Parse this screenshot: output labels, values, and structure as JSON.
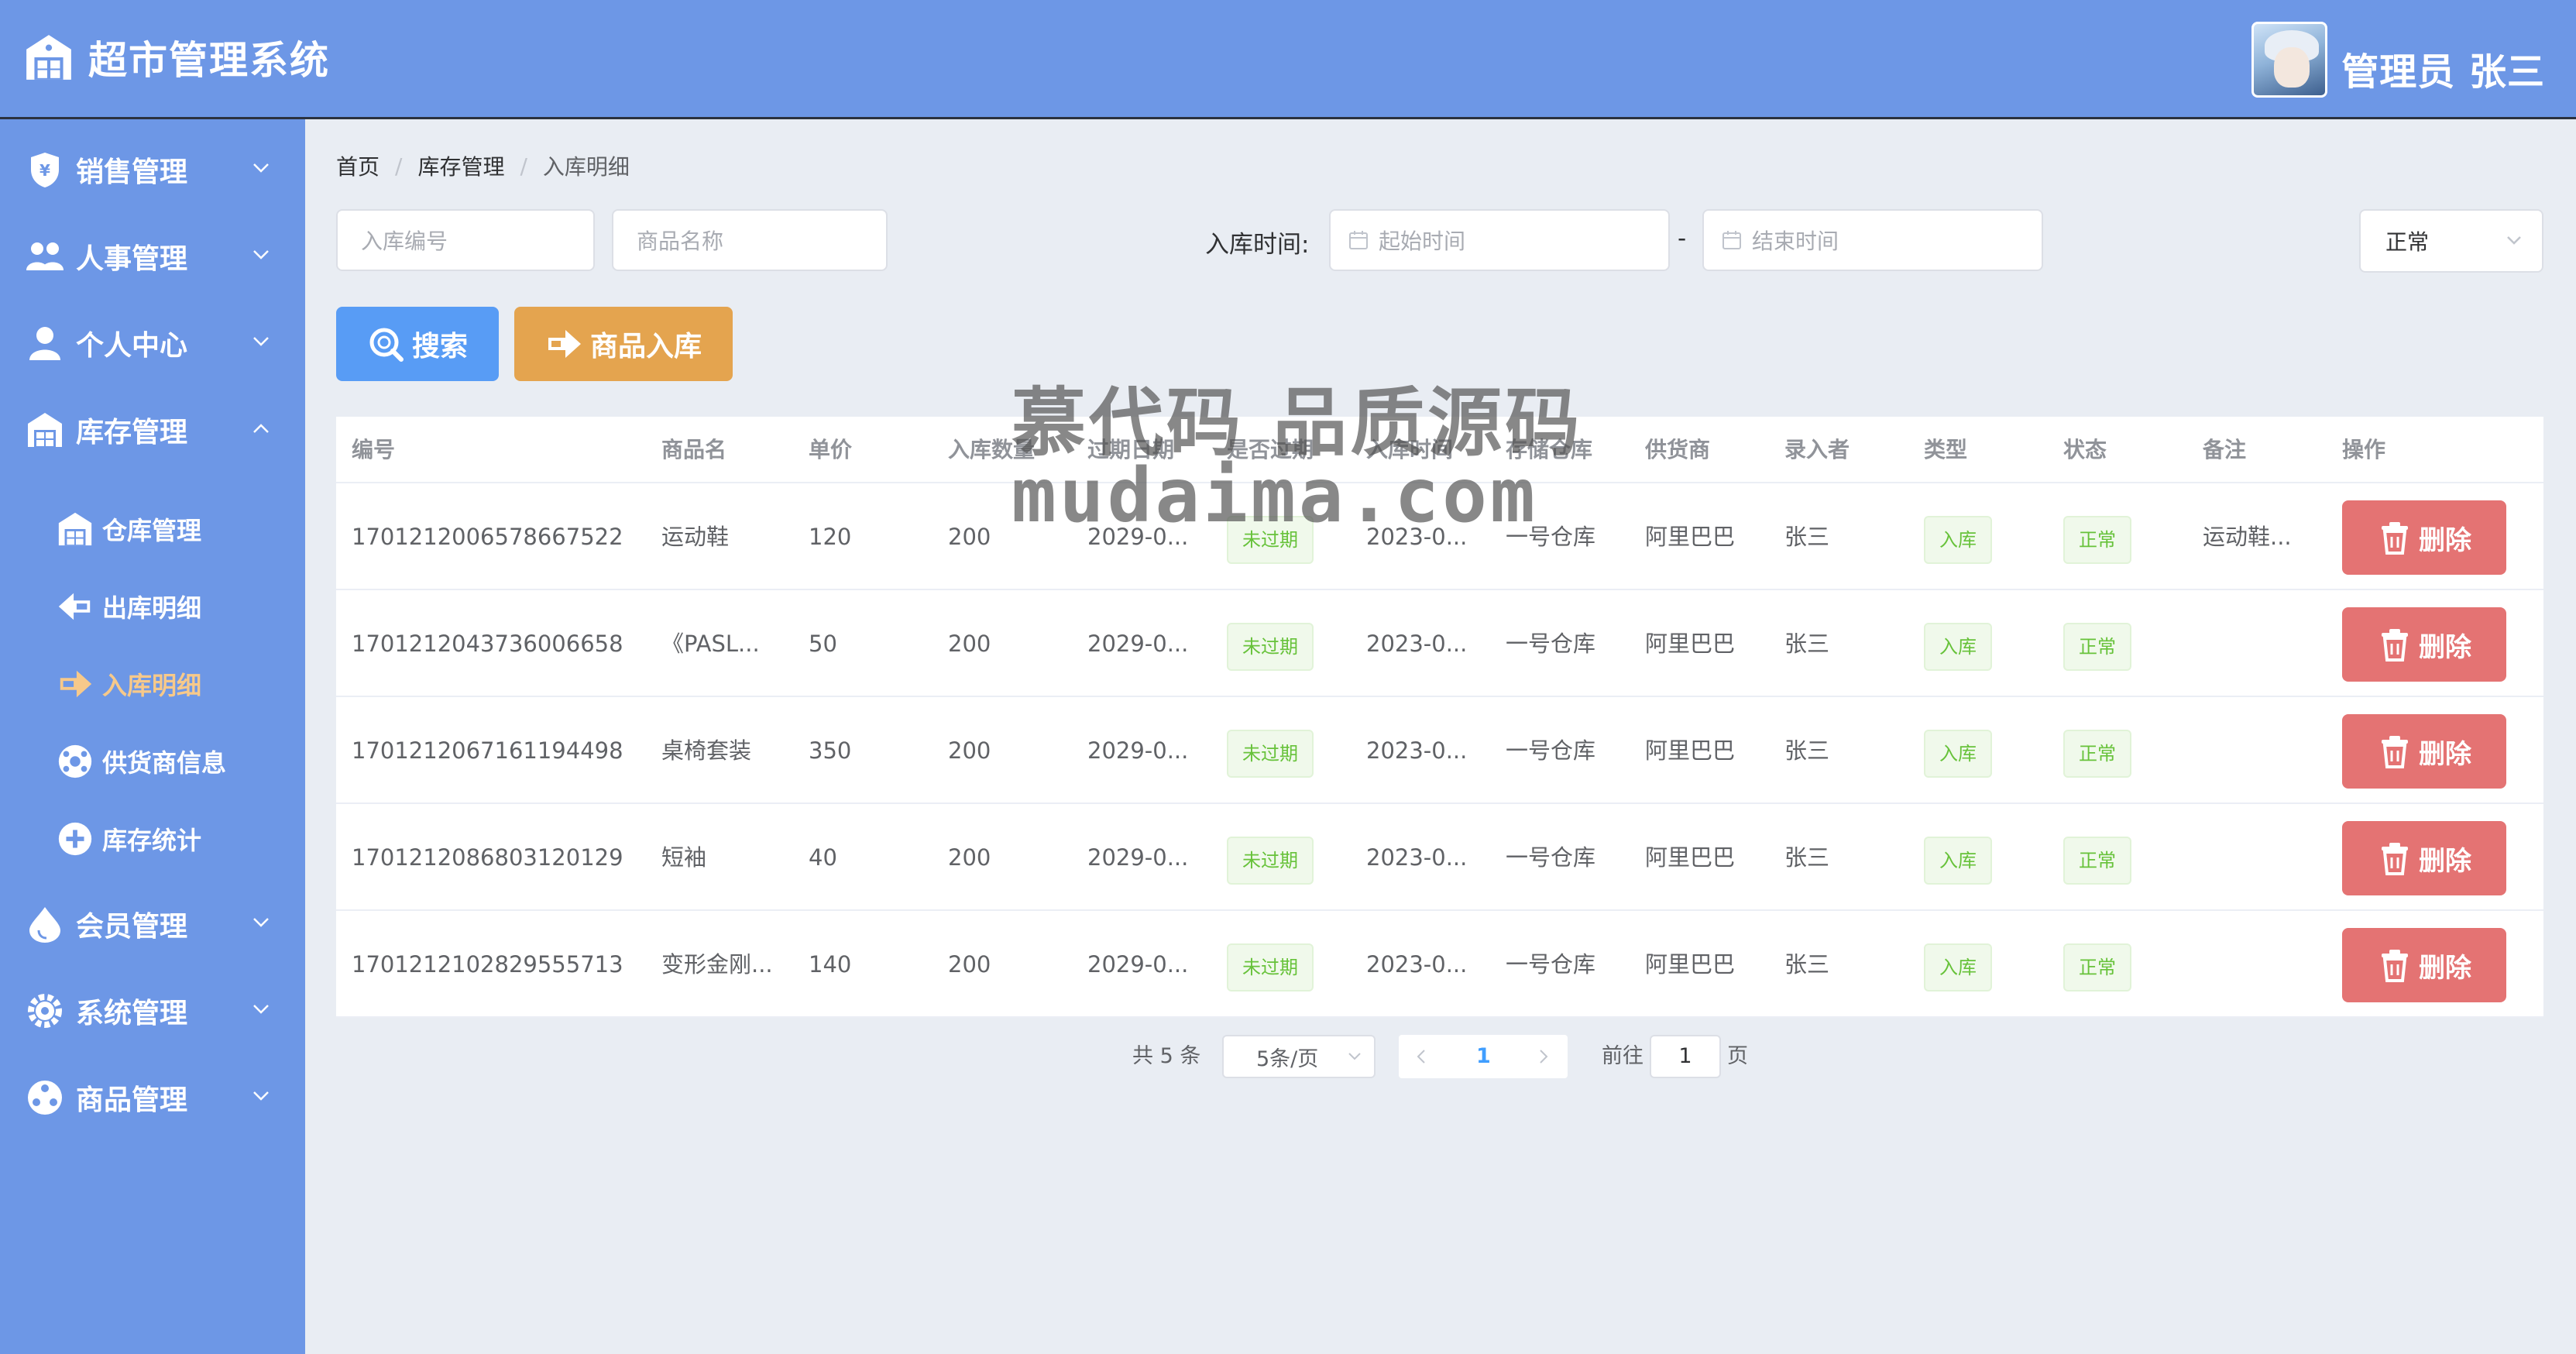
{
  "header": {
    "app_title": "超市管理系统",
    "user_label": "管理员 张三"
  },
  "sidebar": {
    "menus": [
      {
        "label": "销售管理",
        "icon": "shield-cash-icon"
      },
      {
        "label": "人事管理",
        "icon": "people-icon"
      },
      {
        "label": "个人中心",
        "icon": "person-icon"
      },
      {
        "label": "库存管理",
        "icon": "warehouse-icon",
        "expanded": true
      },
      {
        "label": "会员管理",
        "icon": "drop-icon"
      },
      {
        "label": "系统管理",
        "icon": "gear-icon"
      },
      {
        "label": "商品管理",
        "icon": "grid-circle-icon"
      }
    ],
    "submenu": [
      {
        "label": "仓库管理",
        "icon": "warehouse-icon"
      },
      {
        "label": "出库明细",
        "icon": "arrow-left-icon"
      },
      {
        "label": "入库明细",
        "icon": "arrow-right-icon",
        "active": true
      },
      {
        "label": "供货商信息",
        "icon": "globe-icon"
      },
      {
        "label": "库存统计",
        "icon": "plus-circle-icon"
      }
    ]
  },
  "breadcrumb": [
    "首页",
    "库存管理",
    "入库明细"
  ],
  "filters": {
    "code_placeholder": "入库编号",
    "name_placeholder": "商品名称",
    "time_label": "入库时间:",
    "start_placeholder": "起始时间",
    "range_separator": "-",
    "end_placeholder": "结束时间",
    "status_value": "正常"
  },
  "buttons": {
    "search": "搜索",
    "stock_in": "商品入库",
    "delete": "删除"
  },
  "table": {
    "headers": [
      "编号",
      "商品名",
      "单价",
      "入库数量",
      "过期日期",
      "是否过期",
      "入库时间",
      "存储仓库",
      "供货商",
      "录入者",
      "类型",
      "状态",
      "备注",
      "操作"
    ],
    "rows": [
      {
        "id": "1701212006578667522",
        "name": "运动鞋",
        "price": "120",
        "qty": "200",
        "expire": "2029-0...",
        "expired": "未过期",
        "time": "2023-0...",
        "warehouse": "一号仓库",
        "supplier": "阿里巴巴",
        "operator": "张三",
        "type": "入库",
        "status": "正常",
        "remark": "运动鞋..."
      },
      {
        "id": "1701212043736006658",
        "name": "《PASL...",
        "price": "50",
        "qty": "200",
        "expire": "2029-0...",
        "expired": "未过期",
        "time": "2023-0...",
        "warehouse": "一号仓库",
        "supplier": "阿里巴巴",
        "operator": "张三",
        "type": "入库",
        "status": "正常",
        "remark": ""
      },
      {
        "id": "1701212067161194498",
        "name": "桌椅套装",
        "price": "350",
        "qty": "200",
        "expire": "2029-0...",
        "expired": "未过期",
        "time": "2023-0...",
        "warehouse": "一号仓库",
        "supplier": "阿里巴巴",
        "operator": "张三",
        "type": "入库",
        "status": "正常",
        "remark": ""
      },
      {
        "id": "1701212086803120129",
        "name": "短袖",
        "price": "40",
        "qty": "200",
        "expire": "2029-0...",
        "expired": "未过期",
        "time": "2023-0...",
        "warehouse": "一号仓库",
        "supplier": "阿里巴巴",
        "operator": "张三",
        "type": "入库",
        "status": "正常",
        "remark": ""
      },
      {
        "id": "1701212102829555713",
        "name": "变形金刚...",
        "price": "140",
        "qty": "200",
        "expire": "2029-0...",
        "expired": "未过期",
        "time": "2023-0...",
        "warehouse": "一号仓库",
        "supplier": "阿里巴巴",
        "operator": "张三",
        "type": "入库",
        "status": "正常",
        "remark": ""
      }
    ]
  },
  "pagination": {
    "total_text": "共 5 条",
    "page_size": "5条/页",
    "current_page": "1",
    "goto_label": "前往",
    "goto_value": "1",
    "page_suffix": "页"
  },
  "watermark": {
    "line1": "慕代码 品质源码",
    "line2": "mudaima.com"
  },
  "colors": {
    "primary_blue": "#6d97e6",
    "search_btn": "#589cf5",
    "stock_in_btn": "#e4a44f",
    "delete_btn": "#e47373",
    "active_submenu": "#f7c98a",
    "tag_green": "#67c23a"
  }
}
